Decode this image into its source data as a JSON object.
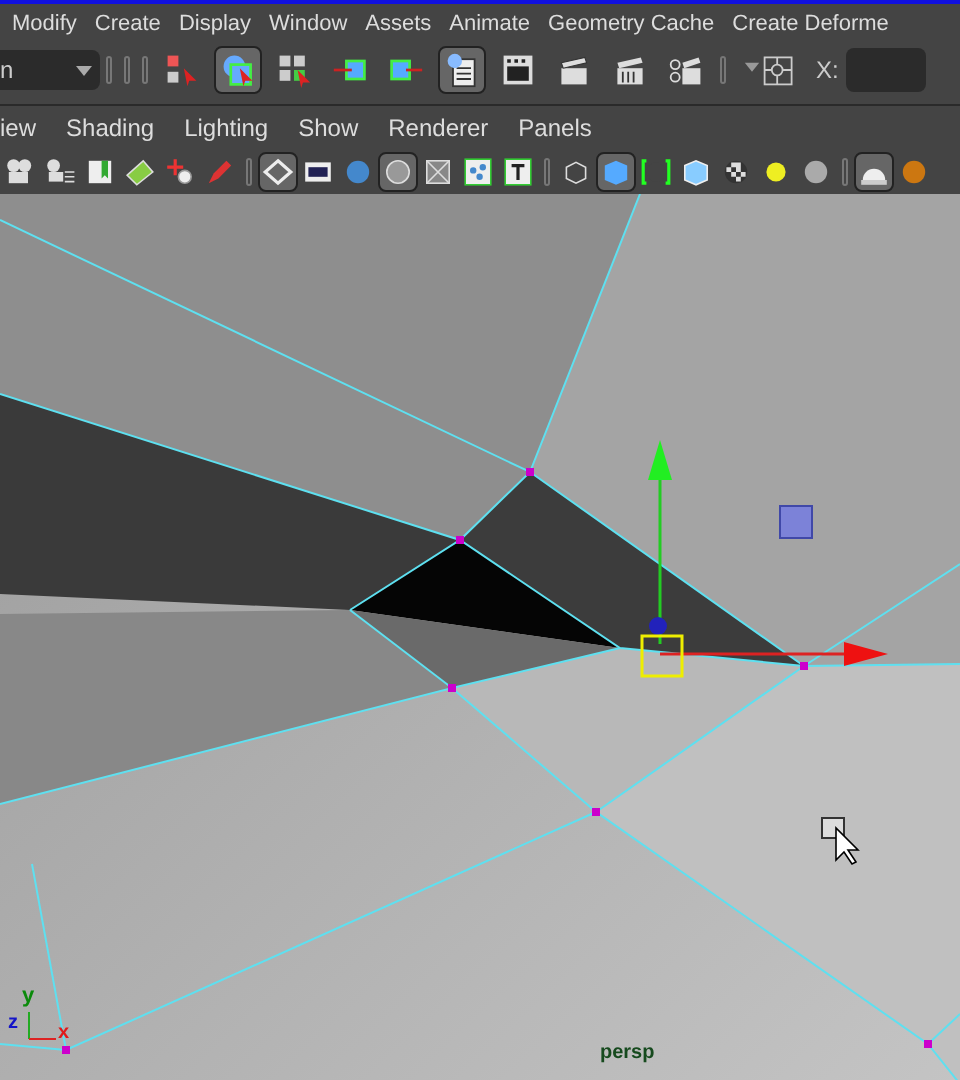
{
  "main_menu": [
    "Modify",
    "Create",
    "Display",
    "Window",
    "Assets",
    "Animate",
    "Geometry Cache",
    "Create Deforme"
  ],
  "toolbar": {
    "mode_dropdown": "n",
    "buttons": [
      {
        "pressed": false
      },
      {
        "pressed": true
      },
      {
        "pressed": false
      },
      {
        "pressed": false
      },
      {
        "pressed": false
      },
      {
        "pressed": true
      },
      {
        "pressed": false
      },
      {
        "pressed": false
      },
      {
        "pressed": false
      },
      {
        "pressed": false
      }
    ],
    "x_label": "X:"
  },
  "panel_menu": [
    "iew",
    "Shading",
    "Lighting",
    "Show",
    "Renderer",
    "Panels"
  ],
  "panel_toolbar": [
    {
      "pressed": false
    },
    {
      "pressed": false
    },
    {
      "pressed": false
    },
    {
      "pressed": false
    },
    {
      "pressed": false
    },
    {
      "pressed": false
    },
    {
      "pressed": true
    },
    {
      "pressed": false
    },
    {
      "pressed": false
    },
    {
      "pressed": true
    },
    {
      "pressed": false
    },
    {
      "pressed": false
    },
    {
      "pressed": false
    },
    {
      "pressed": false
    },
    {
      "pressed": true
    },
    {
      "pressed": false
    },
    {
      "pressed": false
    },
    {
      "pressed": false
    },
    {
      "pressed": false
    },
    {
      "pressed": false
    },
    {
      "pressed": true
    },
    {
      "pressed": false
    }
  ],
  "viewport": {
    "axis_labels": [
      "y",
      "z",
      "x"
    ],
    "camera_label": "persp"
  }
}
